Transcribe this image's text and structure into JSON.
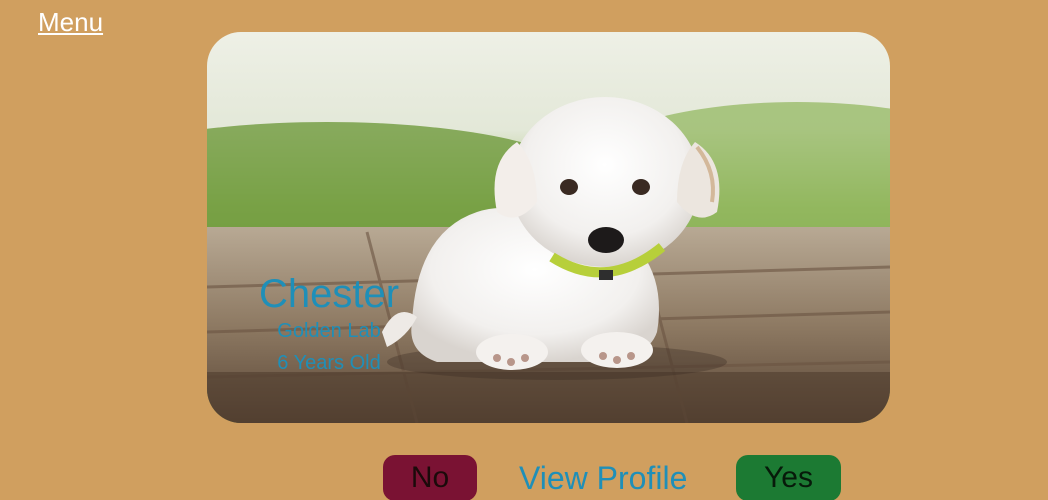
{
  "nav": {
    "menu_label": "Menu"
  },
  "pet": {
    "name": "Chester",
    "breed": "Golden Lab",
    "age": "6 Years Old",
    "photo_subject": "puppy-photo"
  },
  "actions": {
    "no_label": "No",
    "profile_label": "View Profile",
    "yes_label": "Yes"
  },
  "colors": {
    "background": "#d09f5f",
    "accent_text": "#1f8fb8",
    "no_button": "#7a1233",
    "yes_button": "#1c7a33"
  }
}
